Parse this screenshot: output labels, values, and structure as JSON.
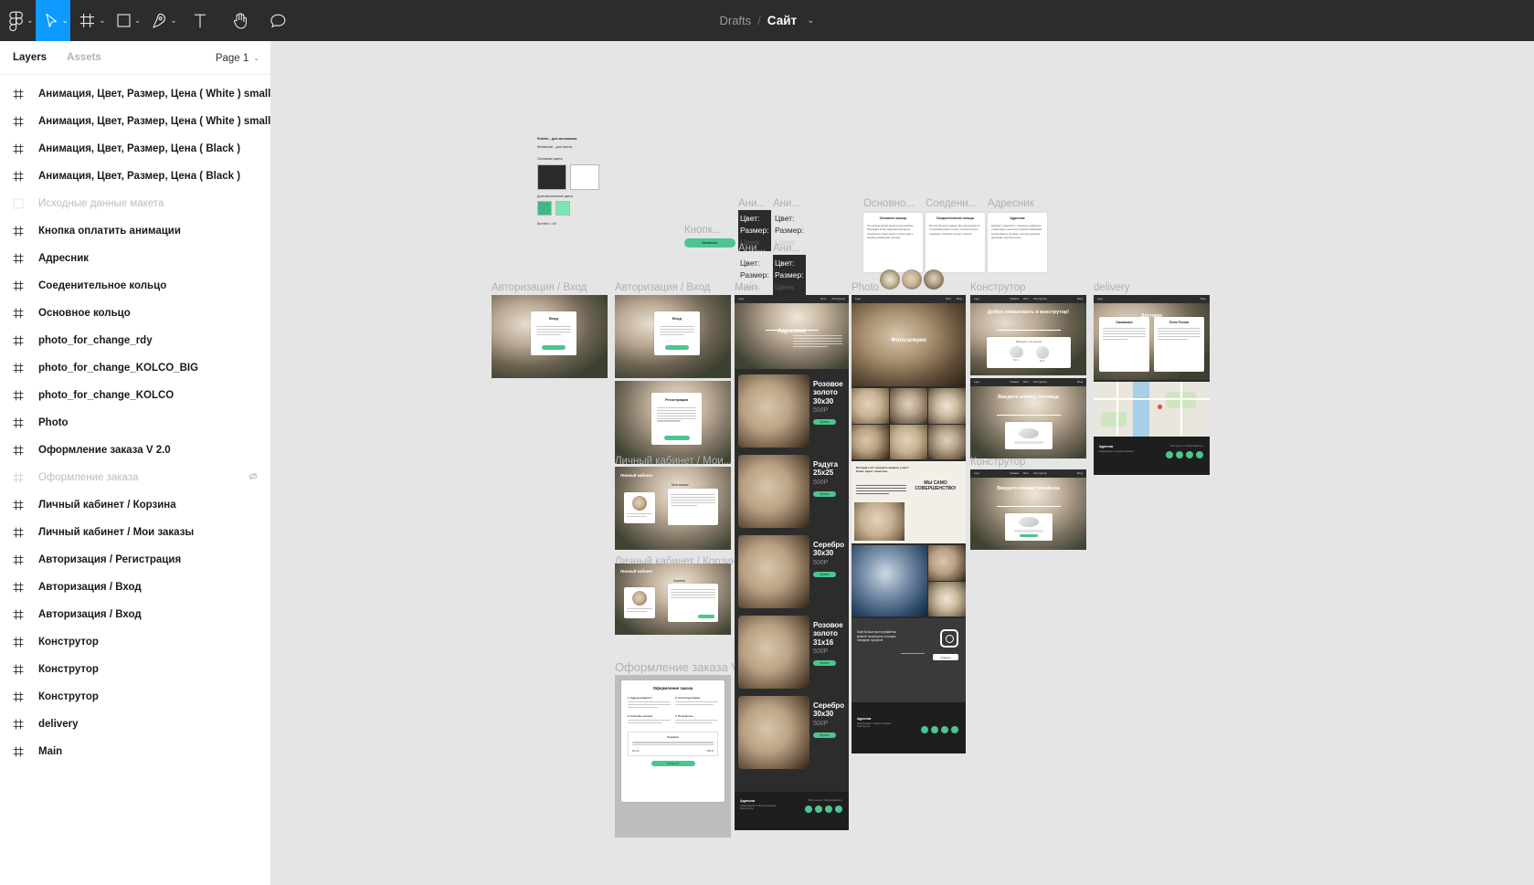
{
  "app": {
    "breadcrumb_root": "Drafts",
    "breadcrumb_sep": "/",
    "file_name": "Сайт",
    "file_chevron": "⌄"
  },
  "toolbar": {
    "items": [
      {
        "name": "figma-logo-icon",
        "label": "",
        "chevron": "⌄",
        "active": false
      },
      {
        "name": "move-tool-icon",
        "label": "",
        "chevron": "⌄",
        "active": true
      },
      {
        "name": "frame-tool-icon",
        "label": "",
        "chevron": "⌄",
        "active": false
      },
      {
        "name": "shape-tool-icon",
        "label": "",
        "chevron": "⌄",
        "active": false
      },
      {
        "name": "pen-tool-icon",
        "label": "",
        "chevron": "⌄",
        "active": false
      },
      {
        "name": "text-tool-icon",
        "label": "",
        "chevron": "",
        "active": false
      },
      {
        "name": "hand-tool-icon",
        "label": "",
        "chevron": "",
        "active": false
      },
      {
        "name": "comment-tool-icon",
        "label": "",
        "chevron": "",
        "active": false
      }
    ]
  },
  "panel": {
    "tabs": [
      {
        "label": "Layers",
        "selected": true
      },
      {
        "label": "Assets",
        "selected": false
      }
    ],
    "page_selector": {
      "label": "Page 1",
      "chevron": "⌄"
    }
  },
  "layers": [
    {
      "label": "Анимация, Цвет, Размер, Цена ( White ) small",
      "icon": "component-icon",
      "hidden": false
    },
    {
      "label": "Анимация, Цвет, Размер, Цена ( White ) small",
      "icon": "component-icon",
      "hidden": false
    },
    {
      "label": "Анимация, Цвет, Размер, Цена ( Black )",
      "icon": "component-icon",
      "hidden": false
    },
    {
      "label": "Анимация, Цвет, Размер, Цена ( Black )",
      "icon": "component-icon",
      "hidden": false
    },
    {
      "label": "Исходные данные макета",
      "icon": "group-icon",
      "hidden": true
    },
    {
      "label": "Кнопка оплатить анимации",
      "icon": "component-icon",
      "hidden": false
    },
    {
      "label": "Адресник",
      "icon": "component-icon",
      "hidden": false
    },
    {
      "label": "Соеденительное кольцо",
      "icon": "component-icon",
      "hidden": false
    },
    {
      "label": "Основное кольцо",
      "icon": "component-icon",
      "hidden": false
    },
    {
      "label": "photo_for_change_rdy",
      "icon": "component-icon",
      "hidden": false
    },
    {
      "label": "photo_for_change_KOLCO_BIG",
      "icon": "component-icon",
      "hidden": false
    },
    {
      "label": "photo_for_change_KOLCO",
      "icon": "component-icon",
      "hidden": false
    },
    {
      "label": "Photo",
      "icon": "component-icon",
      "hidden": false
    },
    {
      "label": "Оформление заказа V 2.0",
      "icon": "component-icon",
      "hidden": false
    },
    {
      "label": "Оформление заказа",
      "icon": "component-icon",
      "hidden": true,
      "eye": "⌐"
    },
    {
      "label": "Личный кабинет / Корзина",
      "icon": "component-icon",
      "hidden": false
    },
    {
      "label": "Личный кабинет / Мои заказы",
      "icon": "component-icon",
      "hidden": false
    },
    {
      "label": "Авторизация / Регистрация",
      "icon": "component-icon",
      "hidden": false
    },
    {
      "label": "Авторизация / Вход",
      "icon": "component-icon",
      "hidden": false
    },
    {
      "label": "Авторизация / Вход",
      "icon": "component-icon",
      "hidden": false
    },
    {
      "label": "Конструтор",
      "icon": "component-icon",
      "hidden": false
    },
    {
      "label": "Конструтор",
      "icon": "component-icon",
      "hidden": false
    },
    {
      "label": "Конструтор",
      "icon": "component-icon",
      "hidden": false
    },
    {
      "label": "delivery",
      "icon": "component-icon",
      "hidden": false
    },
    {
      "label": "Main",
      "icon": "component-icon",
      "hidden": false
    }
  ],
  "canvas": {
    "styleguide": {
      "font_heading": "Roboto - для заголовков",
      "font_body": "Montserrat - для текста",
      "primary_label": "Основные цвета",
      "secondary_label": "Дополнительные цвета",
      "borders_label": "Borders = 40",
      "primary_colors": [
        "#2b2b2b",
        "#ffffff"
      ],
      "secondary_colors": [
        "#40b883",
        "#7ae5b4"
      ]
    },
    "components": [
      {
        "label": "Ани...",
        "theme": "dark",
        "rows": [
          "Цвет:",
          "Размер:",
          "Цена:"
        ]
      },
      {
        "label": "Ани...",
        "theme": "light",
        "rows": [
          "Цвет:",
          "Размер:",
          "Цена:"
        ]
      },
      {
        "label": "Ани...",
        "theme": "light",
        "rows": [
          "Цвет:",
          "Размер:",
          "Цена:"
        ]
      },
      {
        "label": "Ани...",
        "theme": "dark",
        "rows": [
          "Цвет:",
          "Размер:",
          "Цена:"
        ]
      }
    ],
    "pay_button_component": {
      "label": "Кнопк...",
      "button_text": "Оплатить"
    },
    "ring_cards": [
      {
        "frame_label": "Основно...",
        "title": "Основное кольцо",
        "body": "Это кольцо крепко крепится на ошейник. Благодаря этому адресник никогда не потеряется и будет долго служить вам и вашему домашнему питомцу"
      },
      {
        "frame_label": "Соедени...",
        "title": "Соеденительное кольцо",
        "body": "Болтик обычного завода. Мы используем 10-ти миллиметровое кольцо, которое прочно соединяет основное кольцо и брелок."
      },
      {
        "frame_label": "Адресник",
        "title": "Адресник",
        "body": "Красиво и аккуратно с помощью гравёрного станка будет нанесена глубокая гравировка кличка вашего питомца, поэтому адресник прослужит ему всю жизнь."
      }
    ],
    "frames": [
      {
        "label": "Авторизация / Вход",
        "key": "auth_login_1"
      },
      {
        "label": "Авторизация / Вход",
        "key": "auth_login_2"
      },
      {
        "label": "Main",
        "key": "main"
      },
      {
        "label": "Photo",
        "key": "photo"
      },
      {
        "label": "Конструтор",
        "key": "constructor"
      },
      {
        "label": "delivery",
        "key": "delivery"
      },
      {
        "label": "Конструтор",
        "key": "constructor2"
      },
      {
        "label": "Оформление заказа V...",
        "key": "order"
      }
    ],
    "auth": {
      "login_title": "Вход",
      "register_title": "Регистрация",
      "account_title": "Личный кабинет",
      "account_tab": "Мои заказы",
      "account_tab2": "Корзина",
      "button": "Войти",
      "hidden_frame_label_1": "Личный кабинет / Мои...",
      "hidden_frame_label_2": "Личный кабинет / Корзина"
    },
    "main_frame": {
      "hero_title": "Адресник",
      "logo": "Logo",
      "products": [
        {
          "name": "Розовое золото 30х30",
          "price": "500Р",
          "button": "Купить"
        },
        {
          "name": "Радуга 25х25",
          "price": "500Р",
          "button": "Купить"
        },
        {
          "name": "Серебро 30х30",
          "price": "500Р",
          "button": "Купить"
        },
        {
          "name": "Розовое золото 31х16",
          "price": "500Р",
          "button": "Купить"
        },
        {
          "name": "Серебро 30х30",
          "price": "500Р",
          "button": "Купить"
        }
      ],
      "footer_title": "Адресник",
      "footer_sub": "Информация о нашей компании Конструктор",
      "footer_right": "Все соцсети / Подписывайтесь"
    },
    "photo_frame": {
      "hero_title": "Фотогалерея",
      "promo_title": "Личный счет покупать именно у нас? Ответ прост: качество.",
      "slogan": "МЫ САМО СОВЕРШЕНСТВО!",
      "insta_title": "Ещё больше фотографий вы можете посмотреть в нашем Instagram профиле",
      "insta_button": "Открыть",
      "footer_title": "Адресник",
      "footer_sub": "Информация о нашей компании Конструктор"
    },
    "constructor_frame": {
      "title_1": "Добро пожаловать в конструтор!",
      "subtitle_1": "Выберите тип кольца",
      "opt_1": "Тип 1",
      "opt_2": "Тип 2",
      "title_2": "Введите кличку питомца",
      "title_3": "Введите номер телефона",
      "nav": [
        "Logo",
        "Главная",
        "Фото",
        "Конструктор",
        "Вход"
      ]
    },
    "delivery_frame": {
      "title": "Доставка",
      "card_1_title": "Самовывоз",
      "card_2_title": "Почта России",
      "footer_title": "Адресник",
      "footer_sub": "Информация о нашей компании",
      "footer_right": "Все соцсети / Подписывайтесь"
    },
    "order_frame": {
      "label": "Оформление заказа V...",
      "title": "Оформление заказа",
      "steps": [
        "1. Куда доставить?",
        "2. Способ доставки",
        "3. Способы оплаты",
        "4. Получатель"
      ],
      "cart_title": "Корзина",
      "total_label": "Итого:",
      "total_value": "500 Р",
      "submit": "Оплатить"
    }
  }
}
